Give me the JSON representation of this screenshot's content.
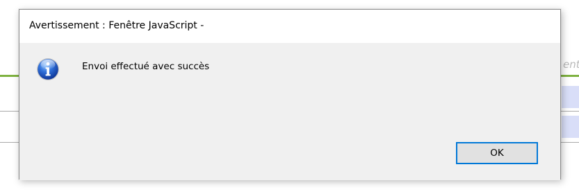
{
  "background": {
    "right_edge_text": "ent",
    "colors": {
      "green_rule": "#7fb241",
      "gray_rule": "#a9a9a9",
      "cell_fill": "#d9def8"
    }
  },
  "dialog": {
    "title": "Avertissement : Fenêtre JavaScript -",
    "icon": "info-icon",
    "message": "Envoi effectué avec succès",
    "ok_label": "OK",
    "colors": {
      "titlebar": "#ffffff",
      "body": "#f0f0f0",
      "button_focus_border": "#0078d7",
      "button_fill": "#e1e1e1"
    }
  }
}
